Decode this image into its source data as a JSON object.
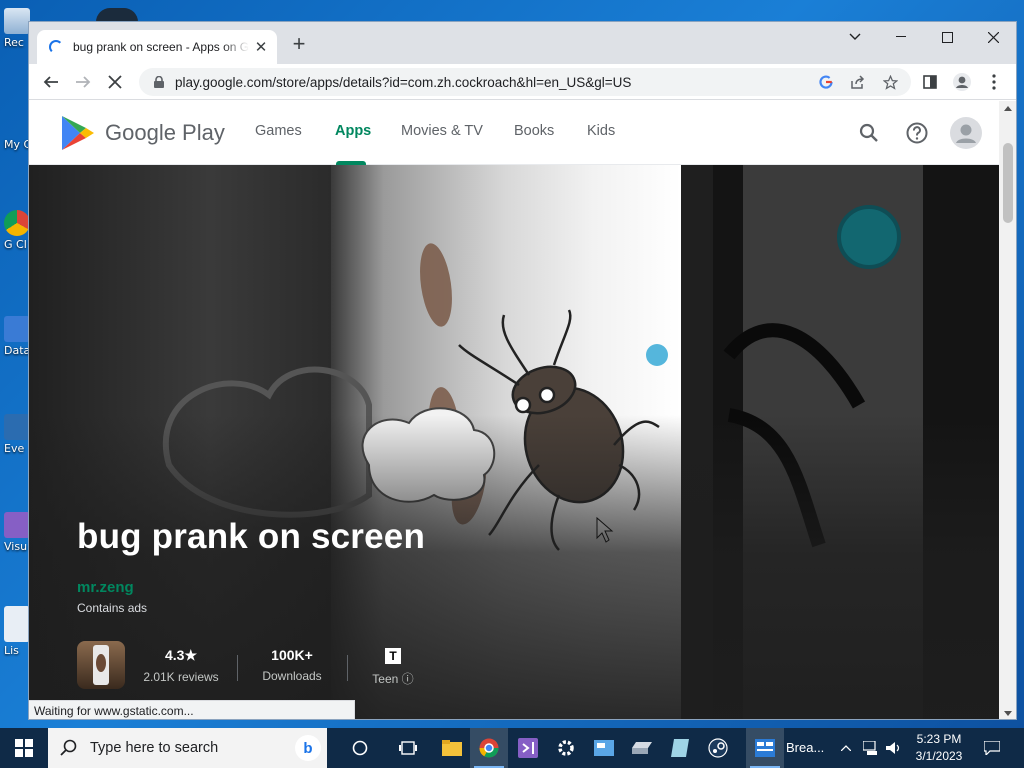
{
  "desktop": {
    "icons": [
      {
        "label": "Rec",
        "icon": "recycle-bin-icon"
      },
      {
        "label": "My C",
        "icon": "computer-icon"
      },
      {
        "label": "G Cl",
        "icon": "chrome-shortcut-icon"
      },
      {
        "label": "Data",
        "icon": "database-icon"
      },
      {
        "label": "Eve",
        "icon": "event-icon"
      },
      {
        "label": "Visu",
        "icon": "visual-studio-icon"
      },
      {
        "label": "Lis",
        "icon": "list-icon"
      }
    ]
  },
  "browser": {
    "tab_title": "bug prank on screen - Apps on Google Play",
    "url": "play.google.com/store/apps/details?id=com.zh.cockroach&hl=en_US&gl=US",
    "status": "Waiting for www.gstatic.com..."
  },
  "play": {
    "brand": "Google Play",
    "nav": [
      "Games",
      "Apps",
      "Movies & TV",
      "Books",
      "Kids"
    ],
    "active_nav": "Apps",
    "accent": "#01875f"
  },
  "app": {
    "title": "bug prank on screen",
    "developer": "mr.zeng",
    "ads": "Contains ads",
    "rating": "4.3★",
    "reviews": "2.01K reviews",
    "downloads": "100K+",
    "downloads_label": "Downloads",
    "content_rating": "Teen",
    "content_rating_icon": "T"
  },
  "taskbar": {
    "search_placeholder": "Type here to search",
    "task_label": "Brea...",
    "time": "5:23 PM",
    "date": "3/1/2023"
  }
}
